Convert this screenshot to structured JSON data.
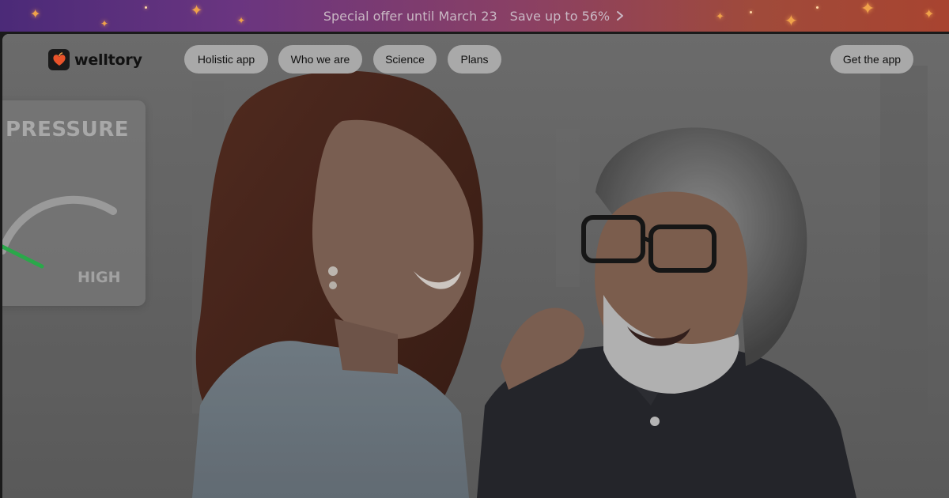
{
  "promo": {
    "offer_text": "Special offer until March 23",
    "save_text": "Save up to 56%",
    "chevron_icon": "chevron-right-icon",
    "sparkle_color": "#f0a24a"
  },
  "header": {
    "logo_text": "welltory",
    "logo_icon": "apple-heart-logo",
    "nav": {
      "holistic_app": "Holistic app",
      "who_we_are": "Who we are",
      "science": "Science",
      "plans": "Plans"
    },
    "cta": "Get the app"
  },
  "hero": {
    "pressure_card": {
      "title": "PRESSURE",
      "high_label": "HIGH"
    }
  },
  "colors": {
    "accent_orange": "#e8532a",
    "pill_bg": "#a9a9a9",
    "gauge_green": "#2aa84a"
  }
}
